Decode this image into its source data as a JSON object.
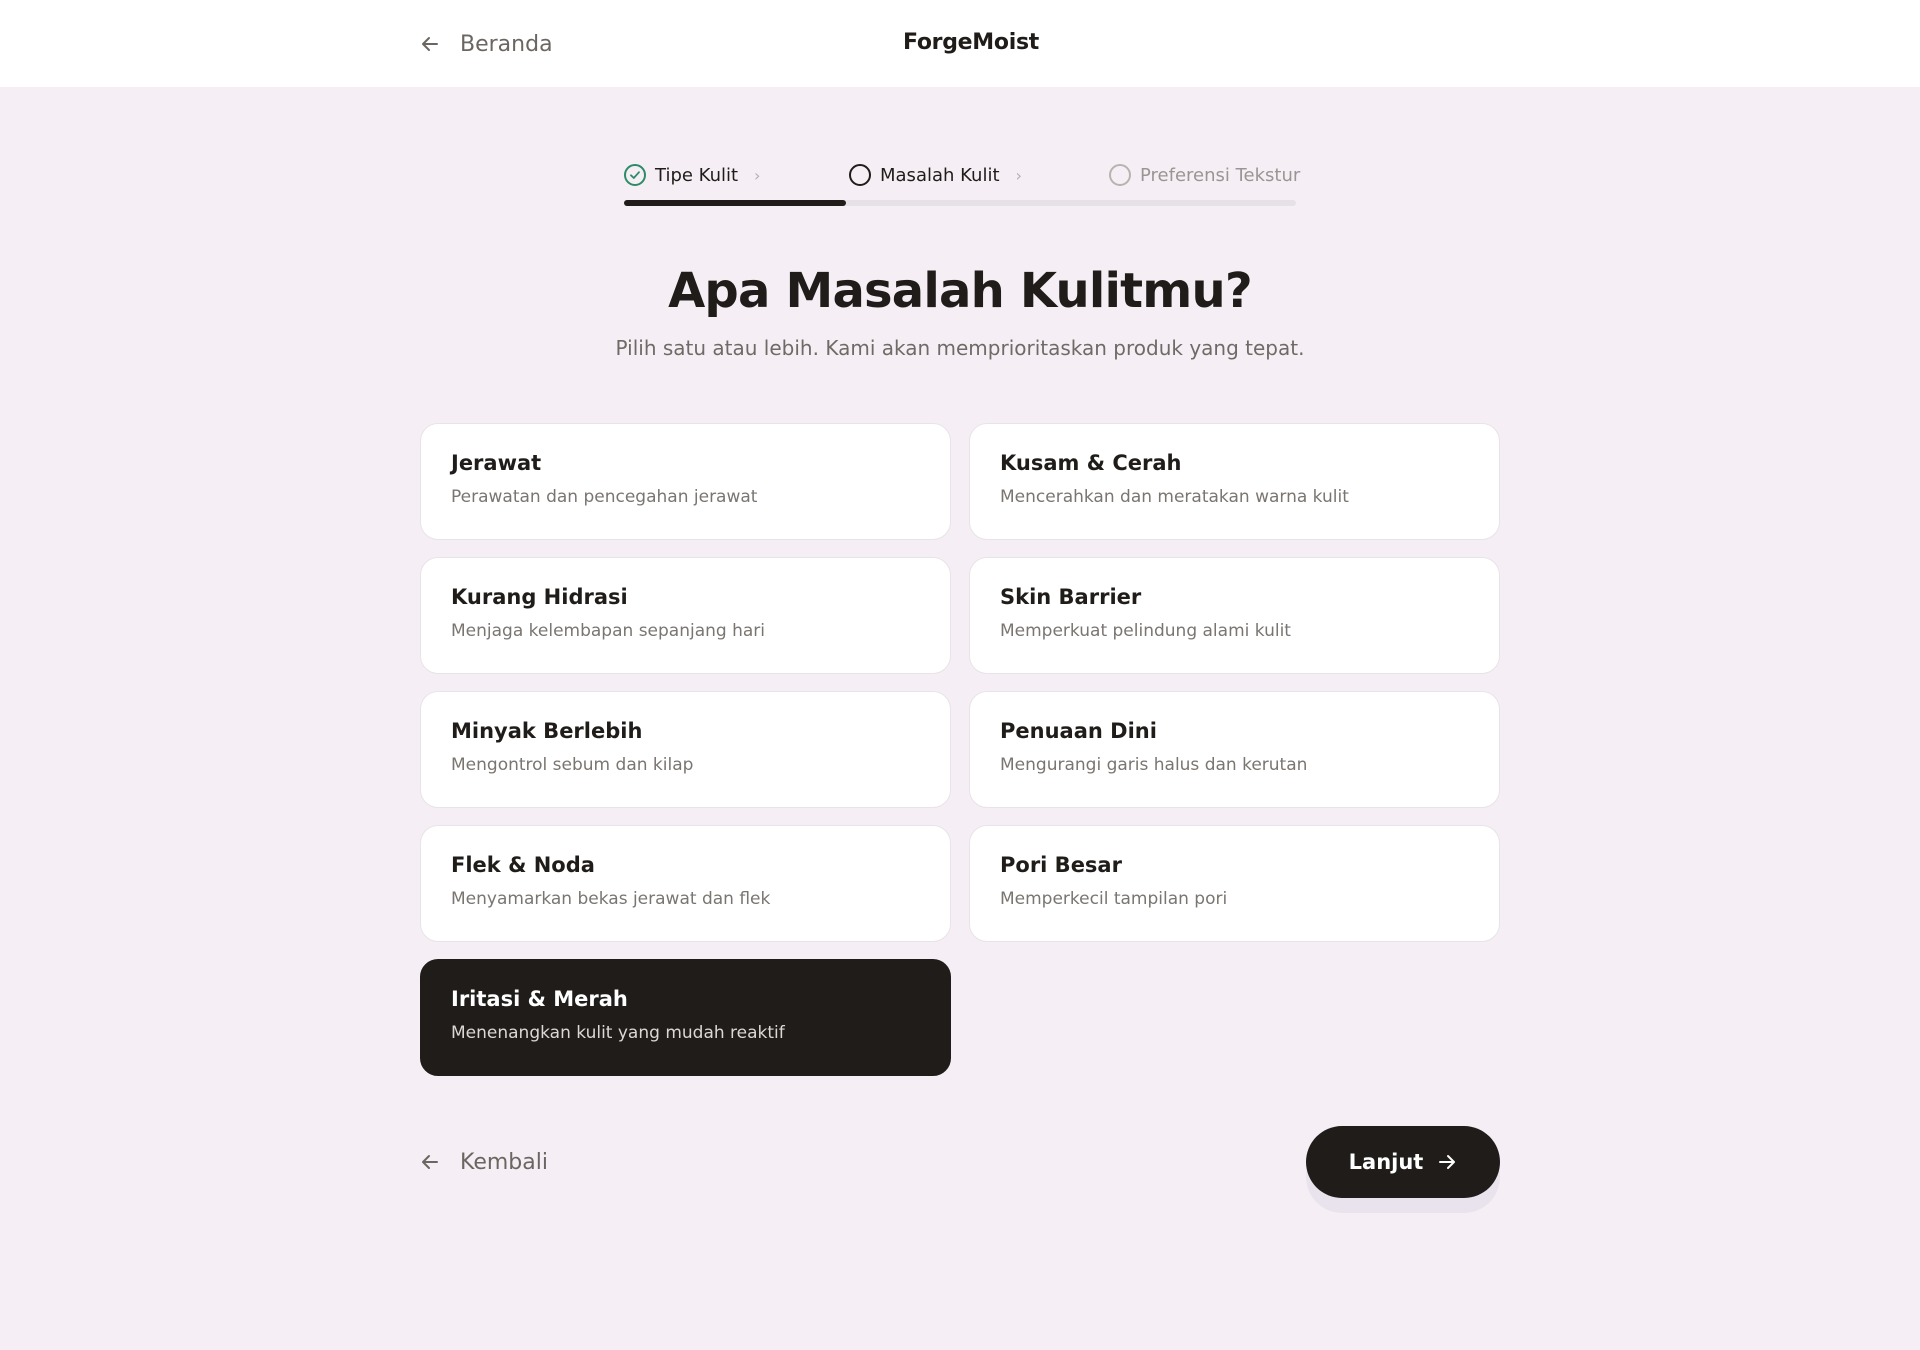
{
  "header": {
    "back_label": "Beranda",
    "brand": "ForgeMoist"
  },
  "stepper": {
    "steps": [
      {
        "label": "Tipe Kulit",
        "status": "completed"
      },
      {
        "label": "Masalah Kulit",
        "status": "active"
      },
      {
        "label": "Preferensi Tekstur",
        "status": "pending"
      }
    ],
    "progress_fraction": 0.33
  },
  "main": {
    "title": "Apa Masalah Kulitmu?",
    "subtitle": "Pilih satu atau lebih. Kami akan memprioritaskan produk yang tepat.",
    "options": [
      {
        "name": "Jerawat",
        "desc": "Perawatan dan pencegahan jerawat",
        "selected": false
      },
      {
        "name": "Kusam & Cerah",
        "desc": "Mencerahkan dan meratakan warna kulit",
        "selected": false
      },
      {
        "name": "Kurang Hidrasi",
        "desc": "Menjaga kelembapan sepanjang hari",
        "selected": false
      },
      {
        "name": "Skin Barrier",
        "desc": "Memperkuat pelindung alami kulit",
        "selected": false
      },
      {
        "name": "Minyak Berlebih",
        "desc": "Mengontrol sebum dan kilap",
        "selected": false
      },
      {
        "name": "Penuaan Dini",
        "desc": "Mengurangi garis halus dan kerutan",
        "selected": false
      },
      {
        "name": "Flek & Noda",
        "desc": "Menyamarkan bekas jerawat dan flek",
        "selected": false
      },
      {
        "name": "Pori Besar",
        "desc": "Memperkecil tampilan pori",
        "selected": false
      },
      {
        "name": "Iritasi & Merah",
        "desc": "Menenangkan kulit yang mudah reaktif",
        "selected": true
      }
    ]
  },
  "footer": {
    "back_label": "Kembali",
    "next_label": "Lanjut"
  },
  "colors": {
    "background": "#f5eff5",
    "dark": "#1f1c19",
    "success": "#2e8a67"
  },
  "icons": {
    "back": "arrow-left-icon",
    "next": "arrow-right-icon",
    "step_done": "check-circle-icon",
    "step_active": "circle-icon",
    "step_pending": "circle-icon",
    "step_separator": "chevron-right-icon"
  }
}
